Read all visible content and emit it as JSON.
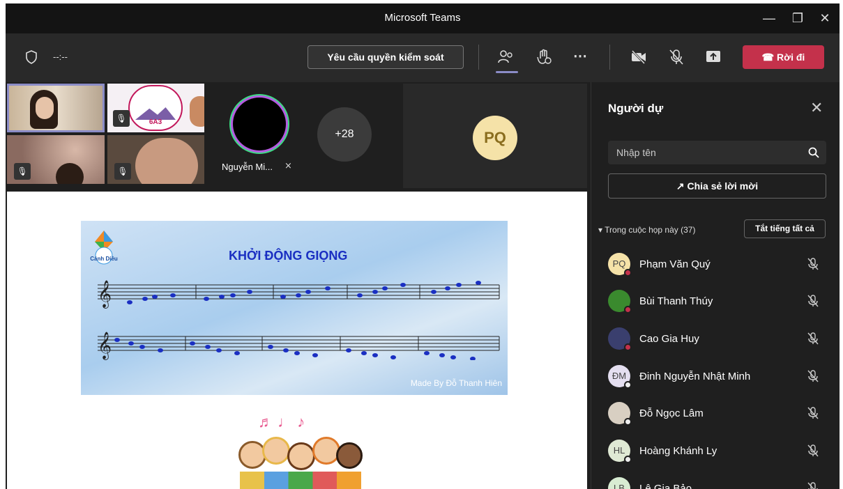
{
  "window": {
    "title": "Microsoft Teams"
  },
  "toolbar": {
    "timer": "--:--",
    "request_control": "Yêu cầu quyền kiểm soát",
    "leave": "Rời đi"
  },
  "stage": {
    "overflow_count": "+28",
    "named_tile": "Nguyễn Mi...",
    "large_tile_initials": "PQ",
    "school_logo_text": "6A3"
  },
  "slide": {
    "title": "KHỞI ĐỘNG GIỌNG",
    "logo": "Cánh Diều",
    "credit": "Made By Đỗ Thanh Hiên"
  },
  "panel": {
    "title": "Người dự",
    "search_placeholder": "Nhập tên",
    "share_invite": "Chia sẻ lời mời",
    "section_label": "Trong cuộc họp này (37)",
    "mute_all": "Tắt tiếng tất cả",
    "participants": [
      {
        "name": "Phạm Văn Quý",
        "initials": "PQ",
        "avatar_color": "#f5e2a8",
        "status": "#c4314b"
      },
      {
        "name": "Bùi Thanh Thúy",
        "initials": "",
        "avatar_color": "#3a8a2e",
        "status": "#c4314b"
      },
      {
        "name": "Cao Gia Huy",
        "initials": "",
        "avatar_color": "#3a3f6e",
        "status": "#c4314b"
      },
      {
        "name": "Đinh Nguyễn Nhật Minh",
        "initials": "ĐM",
        "avatar_color": "#e4dff0",
        "status": "#eeeeee"
      },
      {
        "name": "Đỗ Ngọc Lâm",
        "initials": "",
        "avatar_color": "#d8cfc2",
        "status": "#eeeeee"
      },
      {
        "name": "Hoàng Khánh Ly",
        "initials": "HL",
        "avatar_color": "#dfe9d4",
        "status": "#eeeeee"
      },
      {
        "name": "Lê Gia Bảo",
        "initials": "LB",
        "avatar_color": "#d8ecd2",
        "status": "#eeeeee"
      }
    ]
  },
  "colors": {
    "leave_button": "#c4314b",
    "accent": "#8b8cc7"
  }
}
